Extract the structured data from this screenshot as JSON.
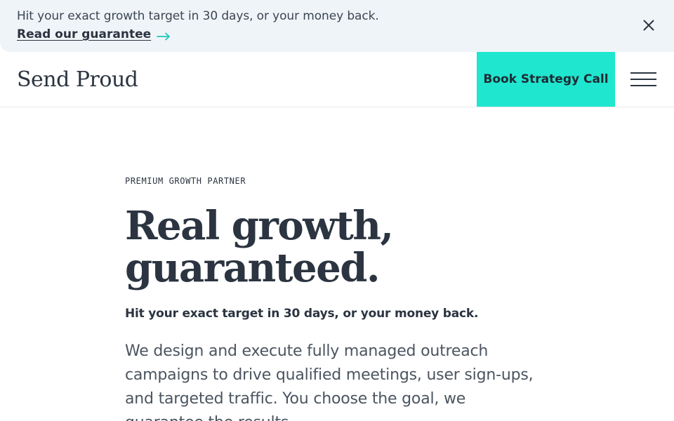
{
  "banner": {
    "message": "Hit your exact growth target in 30 days, or your money back.",
    "link_label": "Read our guarantee",
    "link_icon": "arrow-right-icon",
    "close_icon": "close-icon",
    "accent_color": "#1fe6cf"
  },
  "header": {
    "logo": "Send Proud",
    "cta_label": "Book Strategy Call",
    "cta_color": "#1fe6cf",
    "menu_icon": "hamburger-menu-icon"
  },
  "hero": {
    "eyebrow": "PREMIUM GROWTH PARTNER",
    "headline_line1": "Real growth,",
    "headline_line2": "guaranteed.",
    "subhead": "Hit your exact target in 30 days, or your money back.",
    "body": "We design and execute fully managed outreach campaigns to drive qualified meetings, user sign-ups, and targeted traffic. You choose the goal, we guarantee the results."
  }
}
